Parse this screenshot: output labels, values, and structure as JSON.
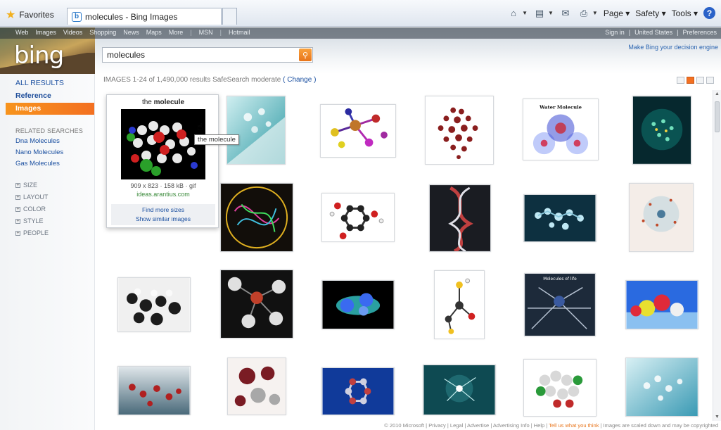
{
  "browser": {
    "favorites_label": "Favorites",
    "tab_title": "molecules - Bing Images",
    "tab_icon_letter": "b",
    "menu_page": "Page",
    "menu_safety": "Safety",
    "menu_tools": "Tools",
    "help_glyph": "?"
  },
  "header": {
    "logo": "bing",
    "nav_left": [
      "Web",
      "Images",
      "Videos",
      "Shopping",
      "News",
      "Maps",
      "More",
      "MSN",
      "Hotmail"
    ],
    "sign_in": "Sign in",
    "region": "United States",
    "preferences": "Preferences",
    "tagline": "Make Bing your decision engine",
    "search_value": "molecules"
  },
  "sidebar": {
    "all_results": "ALL RESULTS",
    "reference": "Reference",
    "images": "Images",
    "related_heading": "RELATED SEARCHES",
    "related": [
      "Dna Molecules",
      "Nano Molecules",
      "Gas Molecules"
    ],
    "filters": [
      "SIZE",
      "LAYOUT",
      "COLOR",
      "STYLE",
      "PEOPLE"
    ]
  },
  "results": {
    "summary": "IMAGES   1-24 of 1,490,000 results   SafeSearch moderate",
    "change": "( Change )"
  },
  "hover_card": {
    "title_prefix": "the ",
    "title_bold": "molecule",
    "meta": "909 x 823 · 158 kB · gif",
    "source": "ideas.arantius.com",
    "find_more": "Find more sizes",
    "show_similar": "Show similar images",
    "tooltip": "the molecule"
  },
  "thumb_caption": "Water Molecule",
  "thumb_caption_2": "Molecules of life",
  "footer": {
    "text": "© 2010 Microsoft  |  Privacy  |  Legal  |  Advertise  |  Advertising Info  |  Help  |  ",
    "feedback": "Tell us what you think",
    "note": "  |  Images are scaled down and may be copyrighted"
  },
  "colors": {
    "accent_orange": "#f37021",
    "link_blue": "#1a4fa0"
  }
}
